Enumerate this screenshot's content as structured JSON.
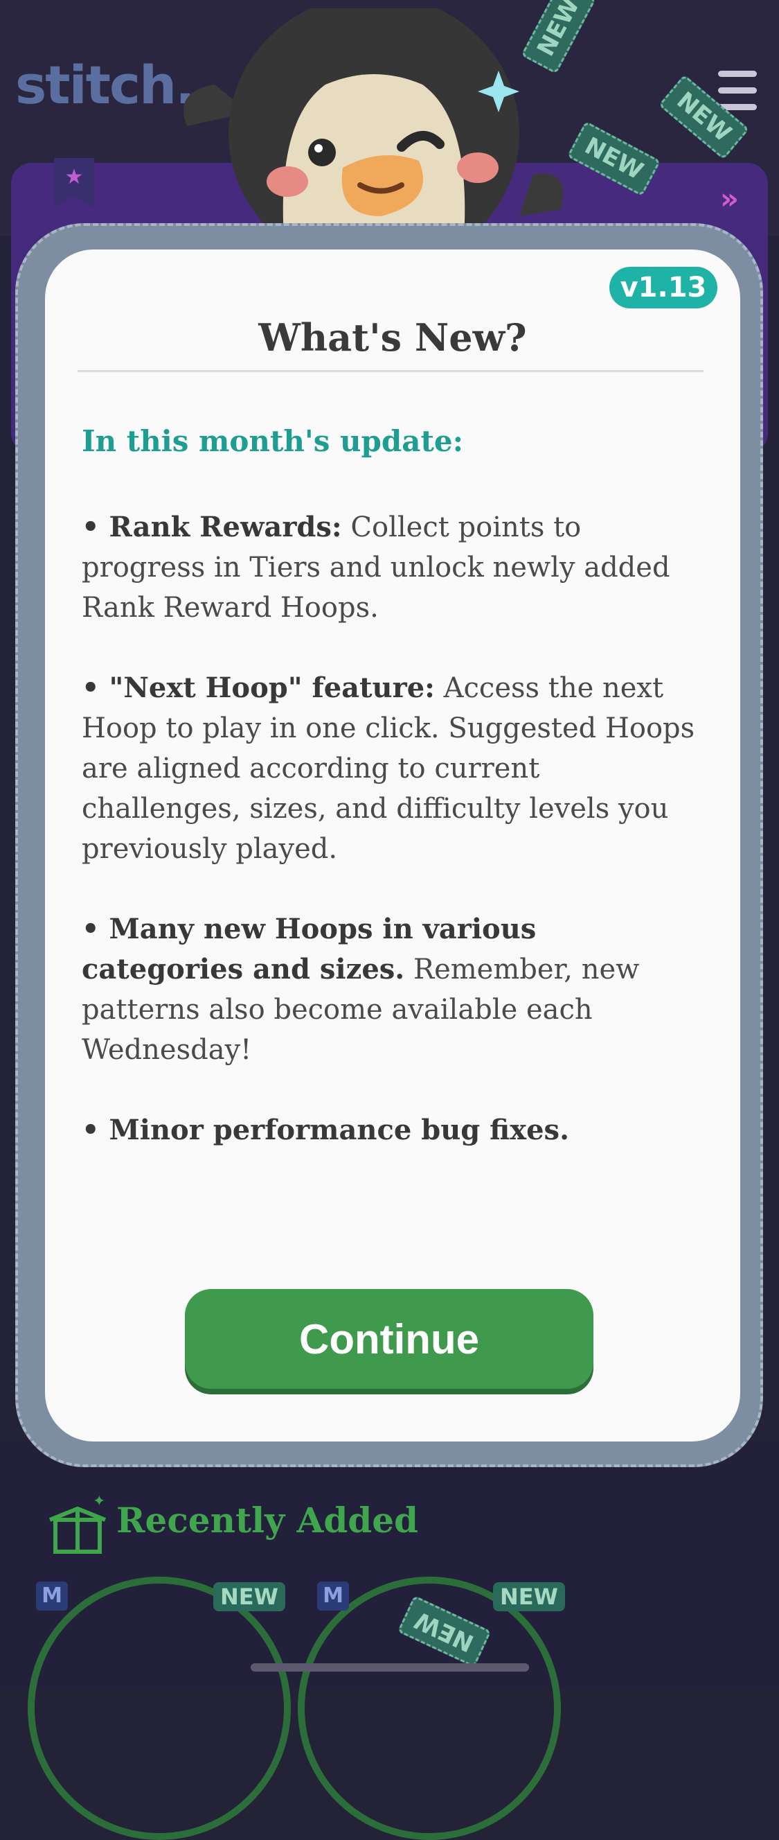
{
  "app": {
    "logo_text": "stitch."
  },
  "background": {
    "new_tag_label": "NEW",
    "recently_added_title": "Recently Added",
    "hoop_badge": "M",
    "hoop_new_label": "NEW"
  },
  "modal": {
    "version": "v1.13",
    "title": "What's New?",
    "section_heading": "In this month's update:",
    "notes": [
      {
        "bold": "• Rank Rewards:",
        "text": " Collect points to progress in Tiers and unlock newly added Rank Reward Hoops."
      },
      {
        "bold": "• \"Next Hoop\" feature:",
        "text": " Access the next Hoop to play in one click. Suggested Hoops are aligned according to current challenges, sizes, and difficulty levels you previously played."
      },
      {
        "bold": "• Many new Hoops in various categories and sizes.",
        "text": " Remember, new patterns also become available each Wednesday!"
      },
      {
        "bold": "• Minor performance bug fixes.",
        "text": ""
      }
    ],
    "continue_label": "Continue"
  },
  "colors": {
    "accent_teal": "#1fb2a6",
    "button_green": "#3f9a4e",
    "background": "#242236"
  }
}
